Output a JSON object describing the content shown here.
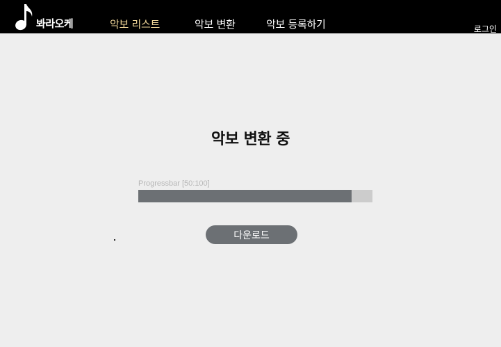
{
  "header": {
    "logo_icon": "music-note-icon",
    "logo_text": "봐라오케",
    "nav": [
      {
        "label": "악보 리스트",
        "active": true
      },
      {
        "label": "악보 변환",
        "active": false
      },
      {
        "label": "악보 등록하기",
        "active": false
      }
    ],
    "login_label": "로그인"
  },
  "main": {
    "title": "악보 변환 중",
    "progress": {
      "label": "Progressbar [50:100]",
      "percent": 91
    },
    "download_label": "다운로드"
  },
  "colors": {
    "navbar_bg": "#000000",
    "active_nav": "#f2d89a",
    "page_bg": "#eeeeee",
    "progress_fill": "#6c7074",
    "progress_track": "#cccccc",
    "button_bg": "#6c7074"
  }
}
